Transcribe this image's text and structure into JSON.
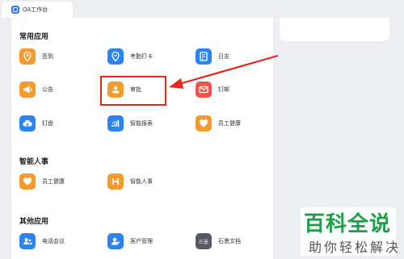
{
  "tab": {
    "title": "OA工作台"
  },
  "sections": {
    "common": {
      "title": "常用应用"
    },
    "hr": {
      "title": "智能人事"
    },
    "other": {
      "title": "其他应用"
    }
  },
  "apps": {
    "sign_in": "签到",
    "attendance": "考勤打卡",
    "journal": "日志",
    "notice": "公告",
    "approval": "审批",
    "mail": "钉邮",
    "drive": "钉盘",
    "report": "智能报表",
    "health": "员工健康",
    "hr_health": "员工健康",
    "smart_hr": "智能人事",
    "conference": "电话会议",
    "crm": "客户管理",
    "doc": "石墨文档",
    "doc_icon_text": "石墨"
  },
  "watermark": {
    "big": "百科全说",
    "small": "助你轻松解决"
  },
  "colors": {
    "orange": "#f59a2d",
    "blue": "#2b84f3",
    "red": "#ef5448",
    "highlight": "#e8251d",
    "watermark": "#1aa047"
  }
}
